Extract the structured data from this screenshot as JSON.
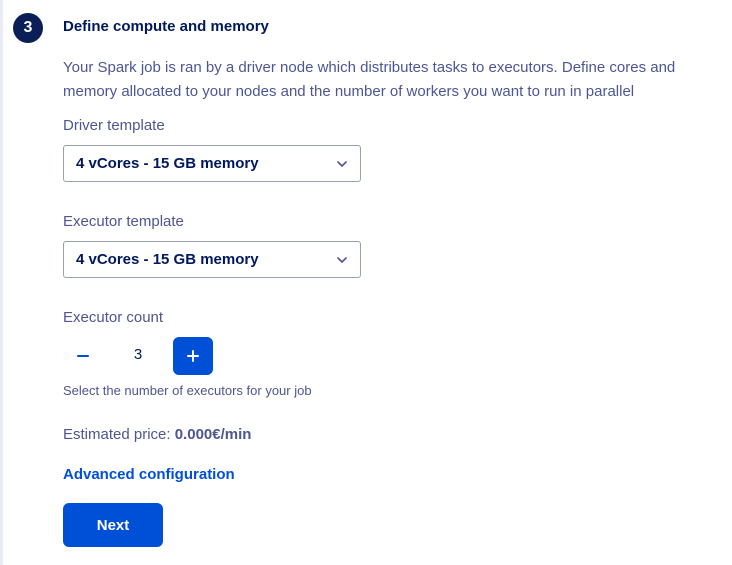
{
  "step": {
    "number": "3",
    "title": "Define compute and memory",
    "description": "Your Spark job is ran by a driver node which distributes tasks to executors. Define cores and memory allocated to your nodes and the number of workers you want to run in parallel"
  },
  "driver": {
    "label": "Driver template",
    "selected": "4 vCores - 15 GB memory"
  },
  "executor": {
    "label": "Executor template",
    "selected": "4 vCores - 15 GB memory"
  },
  "executor_count": {
    "label": "Executor count",
    "value": "3",
    "minus_symbol": "–",
    "plus_symbol": "+",
    "helper": "Select the number of executors for your job"
  },
  "price": {
    "label": "Estimated price:",
    "value": "0.000€/min"
  },
  "links": {
    "advanced": "Advanced configuration"
  },
  "actions": {
    "next": "Next"
  },
  "colors": {
    "primary": "#0050d7",
    "title": "#00185e",
    "text": "#4d5693",
    "badge": "#0b1e57"
  },
  "icons": {
    "select_chevron": "chevron-down-icon"
  }
}
